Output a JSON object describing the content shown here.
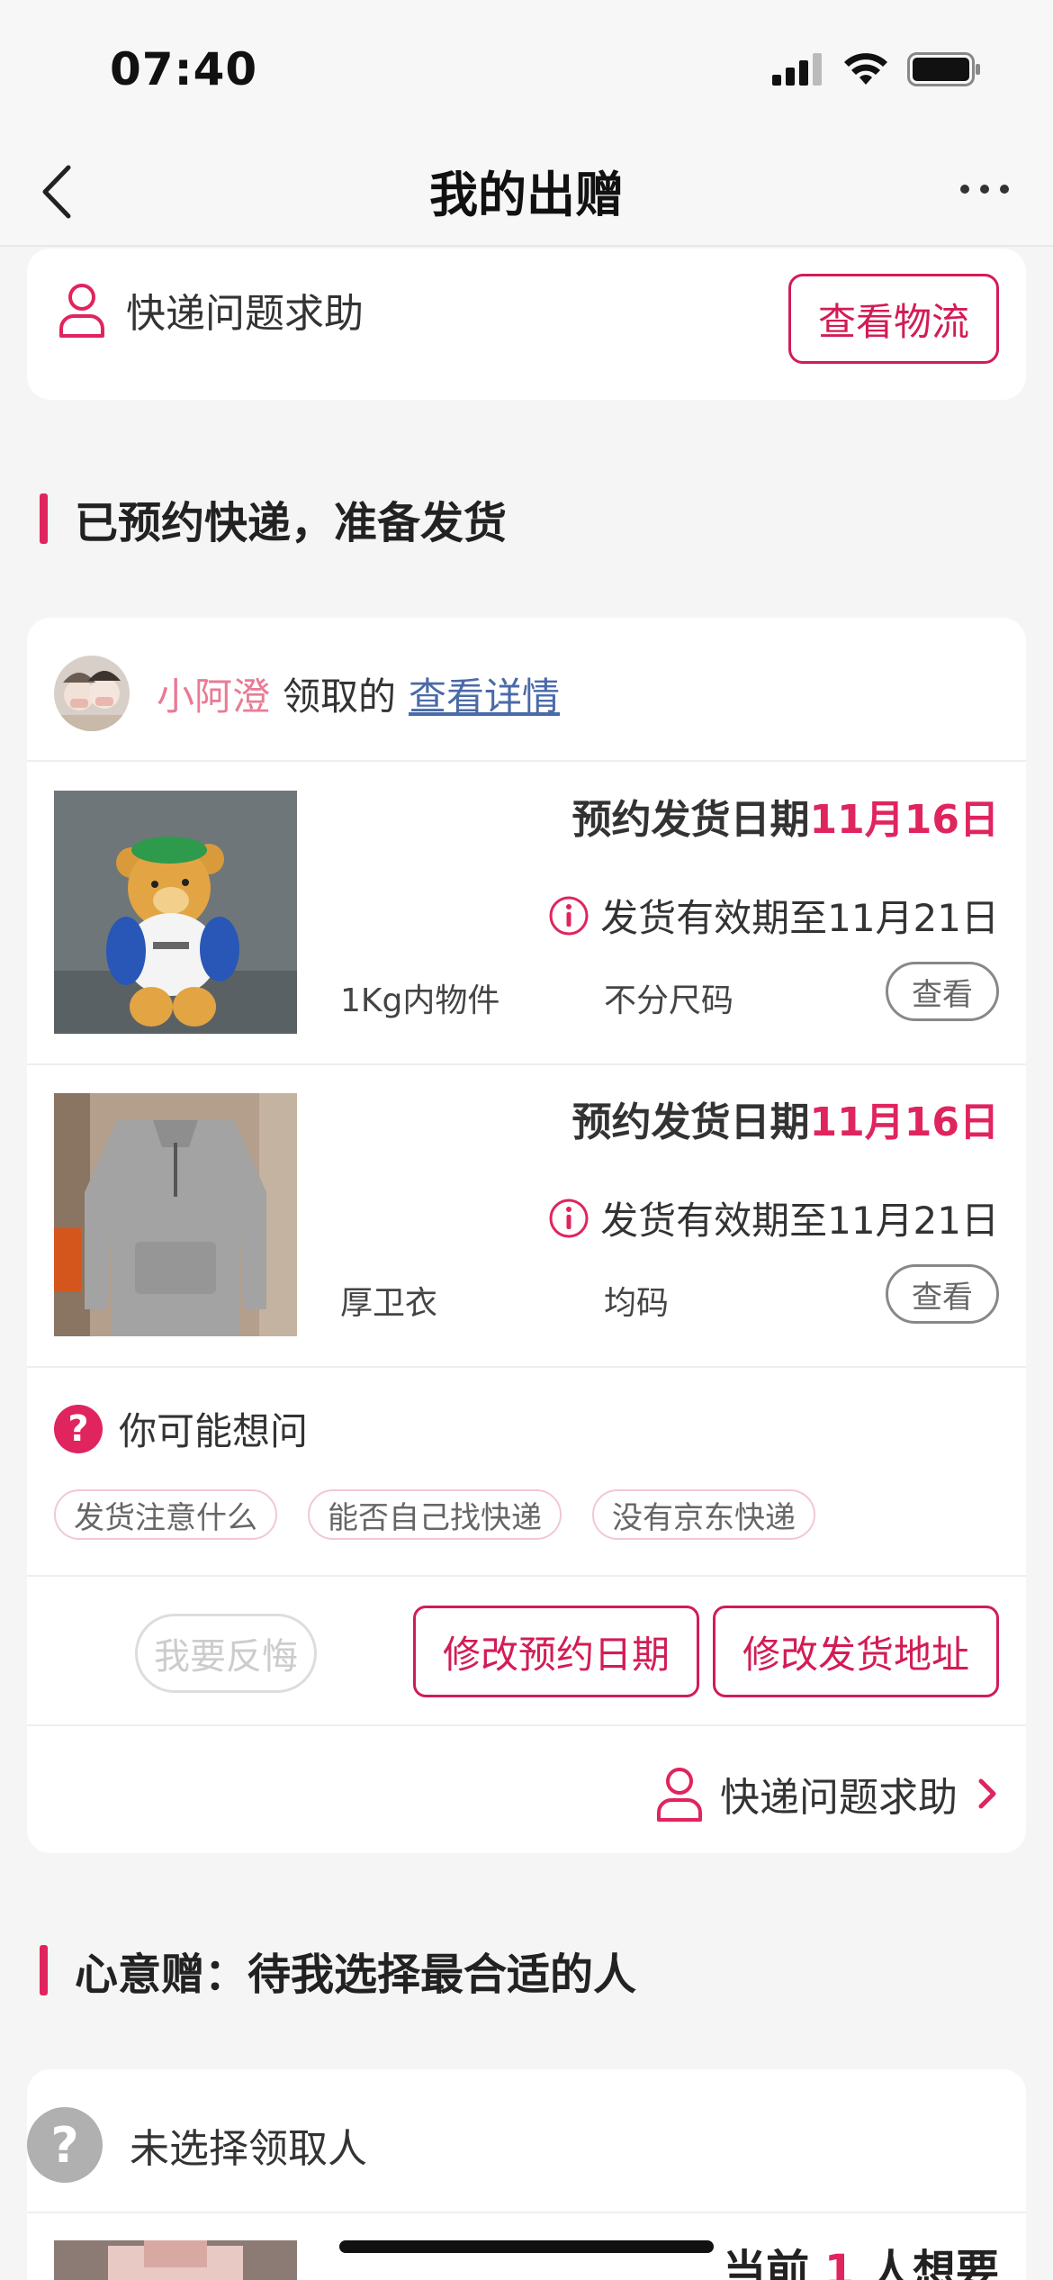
{
  "status": {
    "time": "07:40"
  },
  "nav": {
    "title": "我的出赠"
  },
  "top_card": {
    "help_text": "快递问题求助",
    "logistics_button": "查看物流"
  },
  "section1": {
    "title": "已预约快递，准备发货"
  },
  "order": {
    "receiver_name": "小阿澄",
    "receiver_verb": "领取的",
    "detail_link": "查看详情",
    "items": [
      {
        "ship_label": "预约发货日期",
        "ship_date": "11月16日",
        "validity": "发货有效期至11月21日",
        "name": "1Kg内物件",
        "size": "不分尺码",
        "view": "查看"
      },
      {
        "ship_label": "预约发货日期",
        "ship_date": "11月16日",
        "validity": "发货有效期至11月21日",
        "name": "厚卫衣",
        "size": "均码",
        "view": "查看"
      }
    ],
    "faq_title": "你可能想问",
    "faq_chips": [
      "发货注意什么",
      "能否自己找快递",
      "没有京东快递"
    ],
    "regret_button": "我要反悔",
    "change_date_button": "修改预约日期",
    "change_address_button": "修改发货地址",
    "help_text": "快递问题求助"
  },
  "section2": {
    "title": "心意赠：待我选择最合适的人"
  },
  "pending": {
    "unselected_text": "未选择领取人",
    "want_prefix": "当前",
    "want_count": "1",
    "want_suffix": "人想要"
  },
  "colors": {
    "accent": "#e0245e",
    "link": "#4a6aa8"
  }
}
